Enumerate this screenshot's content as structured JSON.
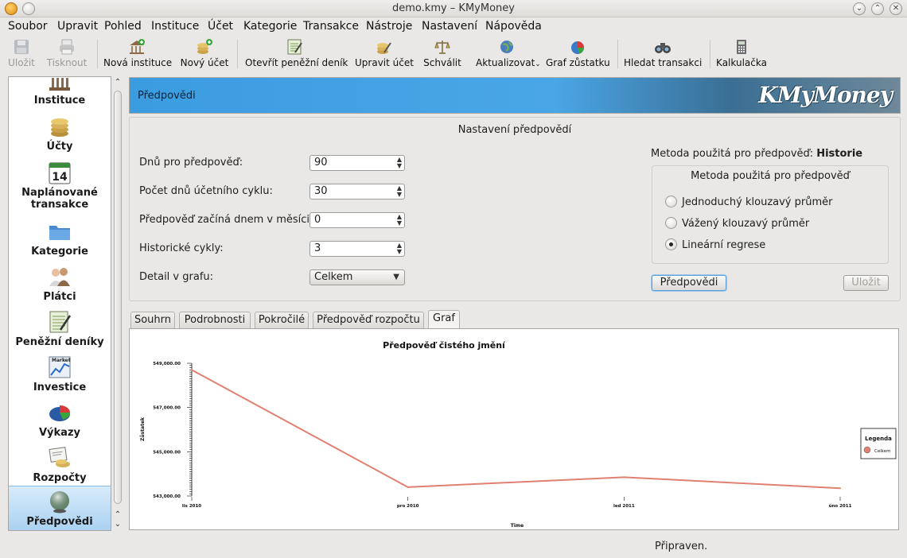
{
  "window": {
    "title": "demo.kmy – KMyMoney"
  },
  "menu": [
    "Soubor",
    "Upravit",
    "Pohled",
    "Instituce",
    "Účet",
    "Kategorie",
    "Transakce",
    "Nástroje",
    "Nastavení",
    "Nápověda"
  ],
  "toolbar": {
    "save": "Uložit",
    "print": "Tisknout",
    "new_institution": "Nová instituce",
    "new_account": "Nový účet",
    "open_ledger": "Otevřít peněžní deník",
    "edit_account": "Upravit účet",
    "reconcile": "Schválit",
    "update": "Aktualizovat",
    "balance_chart": "Graf zůstatku",
    "find_transaction": "Hledat transakci",
    "calculator": "Kalkulačka"
  },
  "sidebar": {
    "items": [
      {
        "label": "Instituce",
        "icon": "institution-icon"
      },
      {
        "label": "Účty",
        "icon": "accounts-icon"
      },
      {
        "label": "Naplánované transakce",
        "icon": "calendar-icon",
        "calendar_day": "14"
      },
      {
        "label": "Kategorie",
        "icon": "categories-icon"
      },
      {
        "label": "Plátci",
        "icon": "payees-icon"
      },
      {
        "label": "Peněžní deníky",
        "icon": "ledger-icon"
      },
      {
        "label": "Investice",
        "icon": "investment-icon",
        "icon_caption": "Market"
      },
      {
        "label": "Výkazy",
        "icon": "reports-icon"
      },
      {
        "label": "Rozpočty",
        "icon": "budget-icon"
      },
      {
        "label": "Předpovědi",
        "icon": "forecast-icon",
        "active": true
      }
    ]
  },
  "banner": {
    "title": "Předpovědi",
    "logo": "KMyMoney"
  },
  "settings": {
    "title": "Nastavení předpovědí",
    "days_label": "Dnů pro předpověď:",
    "days_value": "90",
    "cycle_label": "Počet dnů účetního cyklu:",
    "cycle_value": "30",
    "start_label": "Předpověď začíná dnem v měsíci:",
    "start_value": "0",
    "history_label": "Historické cykly:",
    "history_value": "3",
    "detail_label": "Detail v grafu:",
    "detail_value": "Celkem",
    "method_used_label": "Metoda použitá pro předpověď:",
    "method_used_value": "Historie",
    "method_group_title": "Metoda použitá pro předpověď",
    "methods": [
      {
        "label": "Jednoduchý klouzavý průměr",
        "checked": false
      },
      {
        "label": "Vážený klouzavý průměr",
        "checked": false
      },
      {
        "label": "Lineární regrese",
        "checked": true
      }
    ],
    "forecast_button": "Předpovědi",
    "save_button": "Uložit"
  },
  "tabs": [
    {
      "label": "Souhrn",
      "active": false
    },
    {
      "label": "Podrobnosti",
      "active": false
    },
    {
      "label": "Pokročilé",
      "active": false
    },
    {
      "label": "Předpověď rozpočtu",
      "active": false
    },
    {
      "label": "Graf",
      "active": true
    }
  ],
  "chart_data": {
    "type": "line",
    "title": "Předpověď čistého jmění",
    "xlabel": "Time",
    "ylabel": "Zůstatek",
    "categories": [
      "lis 2010",
      "pro 2010",
      "led 2011",
      "úno 2011"
    ],
    "y_ticks": [
      "549,000.00",
      "547,000.00",
      "545,000.00",
      "543,000.00"
    ],
    "ylim": [
      543000,
      549000
    ],
    "series": [
      {
        "name": "Celkem",
        "color": "#e08070",
        "values": [
          548700,
          543400,
          543850,
          543350
        ]
      }
    ],
    "legend_title": "Legenda",
    "legend_position": "right"
  },
  "status": {
    "text": "Připraven."
  }
}
